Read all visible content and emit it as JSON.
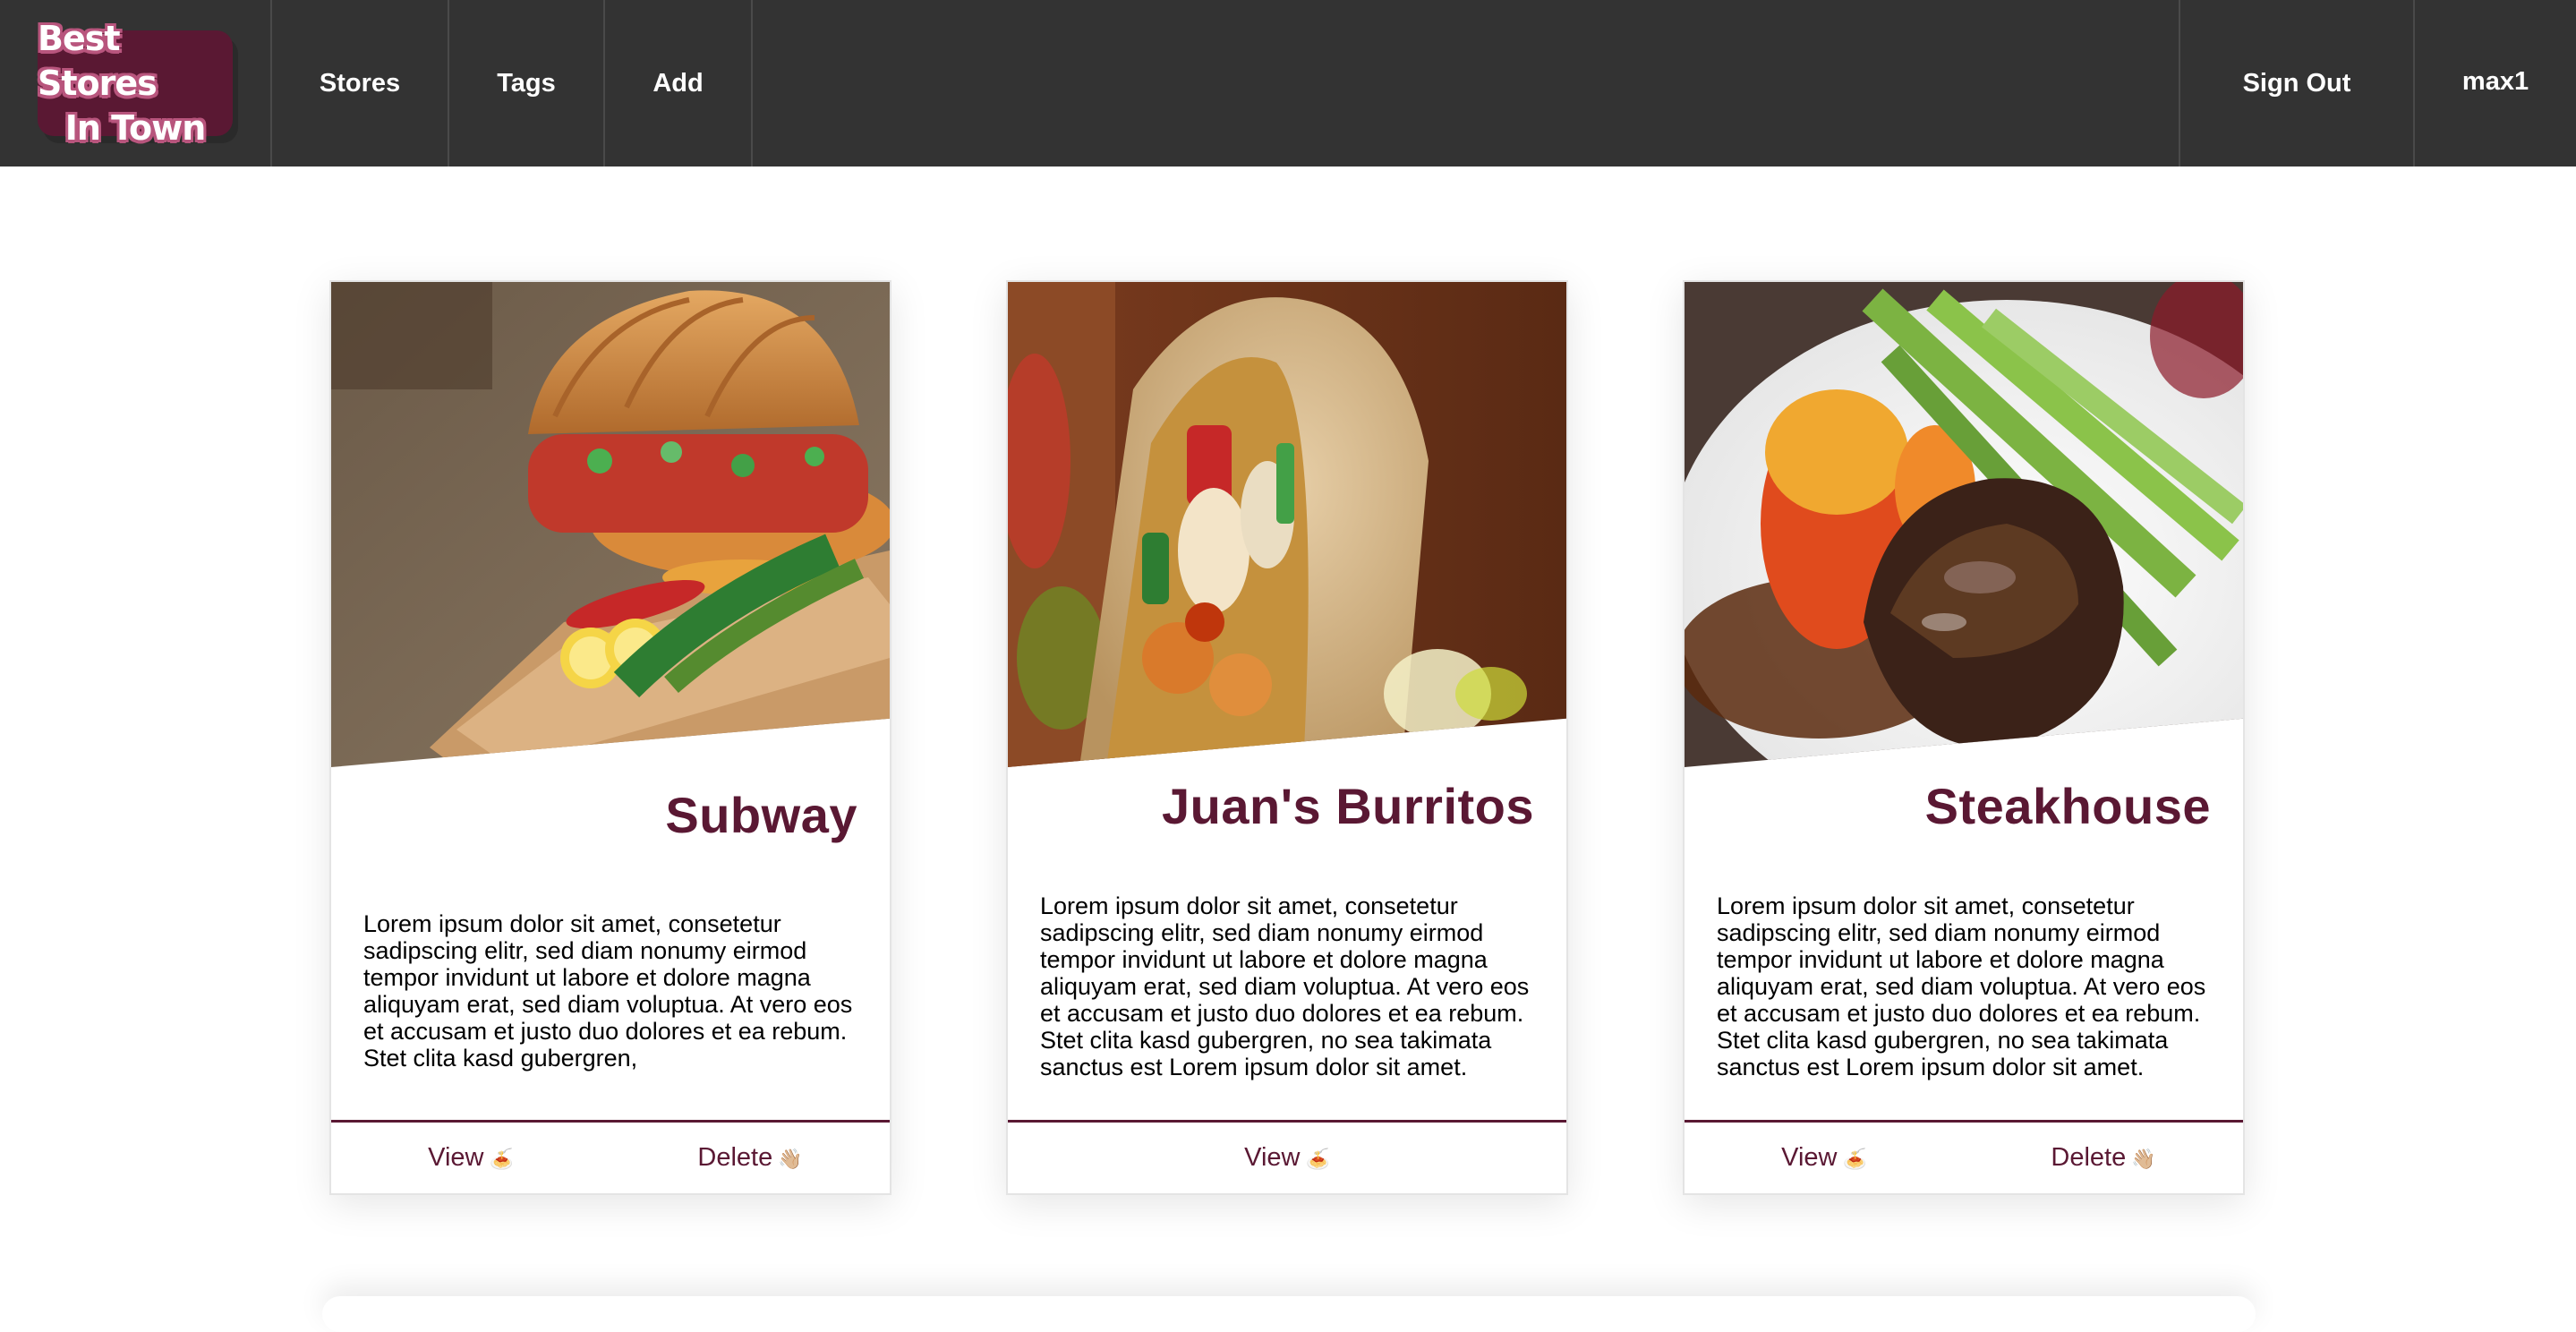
{
  "nav": {
    "logo_line1": "Best Stores",
    "logo_line2": "In Town",
    "links": [
      "Stores",
      "Tags",
      "Add"
    ],
    "sign_out": "Sign Out",
    "user": "max1"
  },
  "stores": [
    {
      "name": "Subway",
      "description": "Lorem ipsum dolor sit amet, consetetur sadipscing elitr, sed diam nonumy eirmod tempor invidunt ut labore et dolore magna aliquyam erat, sed diam voluptua. At vero eos et accusam et justo duo dolores et ea rebum. Stet clita kasd gubergren,",
      "view_label": "View",
      "view_emoji": "🍝",
      "delete_label": "Delete",
      "delete_emoji": "👋🏼"
    },
    {
      "name": "Juan's Burritos",
      "description": "Lorem ipsum dolor sit amet, consetetur sadipscing elitr, sed diam nonumy eirmod tempor invidunt ut labore et dolore magna aliquyam erat, sed diam voluptua. At vero eos et accusam et justo duo dolores et ea rebum. Stet clita kasd gubergren, no sea takimata sanctus est Lorem ipsum dolor sit amet.",
      "view_label": "View",
      "view_emoji": "🍝"
    },
    {
      "name": "Steakhouse",
      "description": "Lorem ipsum dolor sit amet, consetetur sadipscing elitr, sed diam nonumy eirmod tempor invidunt ut labore et dolore magna aliquyam erat, sed diam voluptua. At vero eos et accusam et justo duo dolores et ea rebum. Stet clita kasd gubergren, no sea takimata sanctus est Lorem ipsum dolor sit amet.",
      "view_label": "View",
      "view_emoji": "🍝",
      "delete_label": "Delete",
      "delete_emoji": "👋🏼"
    }
  ],
  "colors": {
    "nav_bg": "#333333",
    "brand": "#5a1833",
    "logo_outline": "#b8557d"
  }
}
